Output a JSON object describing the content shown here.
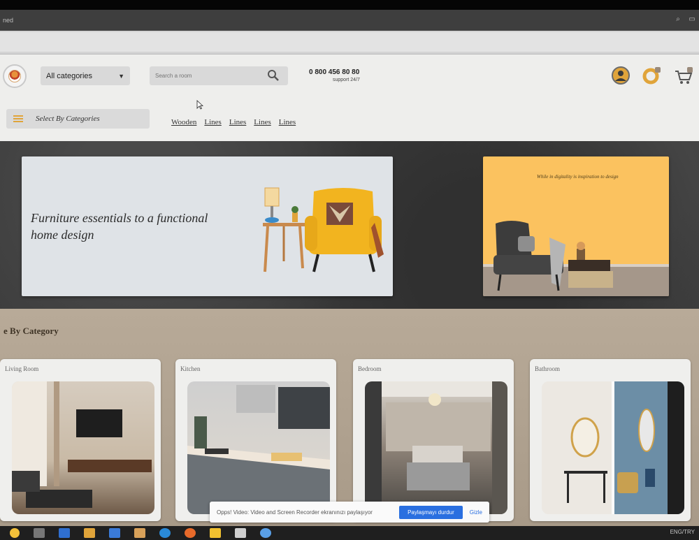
{
  "browser": {
    "tab_title": "ned"
  },
  "header": {
    "category_select": "All categories",
    "search_placeholder": "Search a room",
    "phone": "0 800 456 80 80",
    "phone_sub": "support 24/7"
  },
  "nav": {
    "category_button": "Select By Categories",
    "links": [
      "Wooden",
      "Lines",
      "Lines",
      "Lines",
      "Lines"
    ]
  },
  "hero": {
    "headline": "Furniture essentials to a functional home design",
    "side_tag": "While in digitality is inspiration to design"
  },
  "section": {
    "title": "e By Category",
    "cards": [
      {
        "title": "Living Room"
      },
      {
        "title": "Kitchen"
      },
      {
        "title": "Bedroom"
      },
      {
        "title": "Bathroom"
      }
    ]
  },
  "toast": {
    "message": "Opps! Video: Video and Screen Recorder ekranınızı paylaşıyor",
    "share_button": "Paylaşmayı durdur",
    "hide_button": "Gizle"
  },
  "taskbar": {
    "tray": "ENG/TRY"
  },
  "colors": {
    "accent": "#e0a43a",
    "banner_yellow": "#fbc25f",
    "share_blue": "#2a6fe0"
  }
}
